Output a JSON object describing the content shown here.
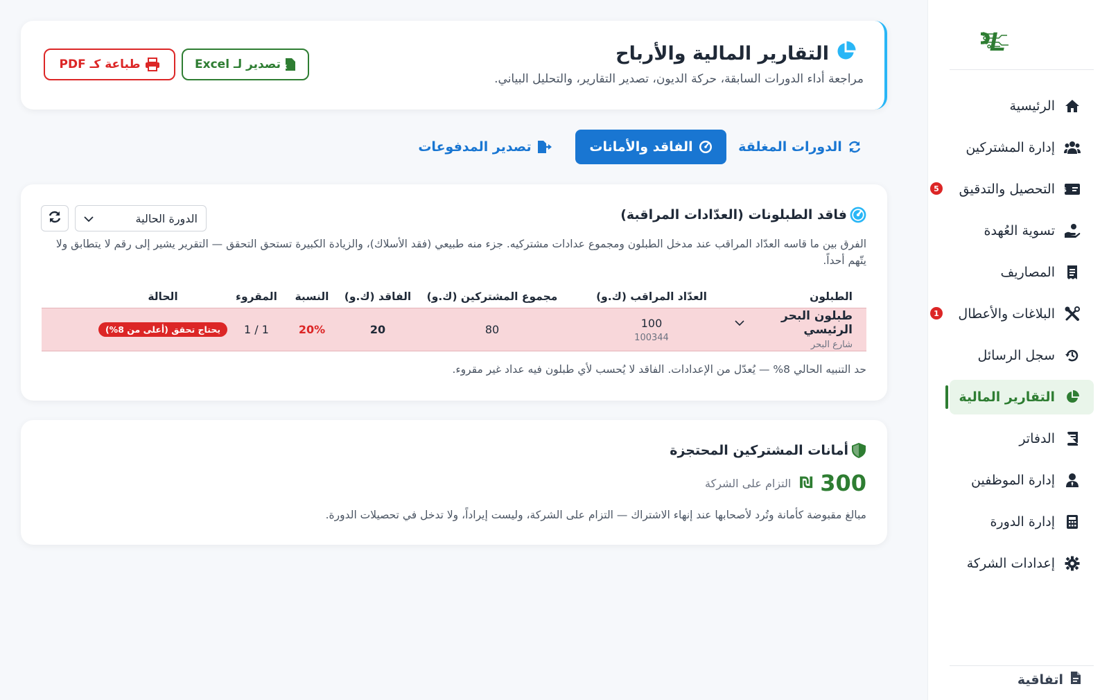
{
  "sidebar": {
    "logo_text": "PL",
    "items": [
      {
        "label": "الرئيسية",
        "icon": "home-icon"
      },
      {
        "label": "إدارة المشتركين",
        "icon": "users-icon"
      },
      {
        "label": "التحصيل والتدقيق",
        "icon": "money-card-icon",
        "badge": "5"
      },
      {
        "label": "تسوية العُهدة",
        "icon": "hand-coin-icon"
      },
      {
        "label": "المصاريف",
        "icon": "receipt-icon"
      },
      {
        "label": "البلاغات والأعطال",
        "icon": "tools-icon",
        "badge": "1"
      },
      {
        "label": "سجل الرسائل",
        "icon": "history-icon"
      },
      {
        "label": "التقارير المالية",
        "icon": "pie-chart-icon",
        "active": true
      },
      {
        "label": "الدفاتر",
        "icon": "book-icon"
      },
      {
        "label": "إدارة الموظفين",
        "icon": "user-tie-icon"
      },
      {
        "label": "إدارة الدورة",
        "icon": "calculator-icon"
      },
      {
        "label": "إعدادات الشركة",
        "icon": "gear-icon"
      }
    ],
    "bottom_label": "اتفاقية"
  },
  "header": {
    "title": "التقارير المالية والأرباح",
    "subtitle": "مراجعة أداء الدورات السابقة، حركة الديون، تصدير التقارير، والتحليل البياني.",
    "excel_label": "تصدير لـ Excel",
    "pdf_label": "طباعة كـ PDF"
  },
  "tabs": {
    "closed": "الدورات المغلقة",
    "loss": "الفاقد والأمانات",
    "export": "تصدير المدفوعات"
  },
  "loss_card": {
    "title": "فاقد الطبلونات (العدّادات المراقبة)",
    "cycle_select": "الدورة الحالية",
    "description": "الفرق بين ما قاسه العدّاد المراقب عند مدخل الطبلون ومجموع عدادات مشتركيه. جزء منه طبيعي (فقد الأسلاك)، والزيادة الكبيرة تستحق التحقق — التقرير يشير إلى رقم لا يتطابق ولا يتّهم أحداً.",
    "columns": [
      "الطبلون",
      "العدّاد المراقب (ك.و)",
      "مجموع المشتركين (ك.و)",
      "الفاقد (ك.و)",
      "النسبة",
      "المقروء",
      "الحالة"
    ],
    "rows": [
      {
        "panel": "طبلون البحر الرئيسي",
        "street": "شارع البحر",
        "meter": "100",
        "meter_id": "100344",
        "subscribers_total": "80",
        "loss": "20",
        "ratio": "20%",
        "read": "1 / 1",
        "status": "يحتاج تحقق (أعلى من 8%)"
      }
    ],
    "note": "حد التنبيه الحالي 8% — يُعدّل من الإعدادات. الفاقد لا يُحسب لأي طبلون فيه عداد غير مقروء."
  },
  "deposit_card": {
    "title": "أمانات المشتركين المحتجزة",
    "amount": "300",
    "currency": "₪",
    "amount_label": "التزام على الشركة",
    "description": "مبالغ مقبوضة كأمانة وتُرد لأصحابها عند إنهاء الاشتراك — التزام على الشركة، وليست إيراداً، ولا تدخل في تحصيلات الدورة."
  },
  "colors": {
    "accent_blue": "#1976d2",
    "brand_green": "#2e7d32",
    "danger_red": "#dc2626",
    "row_alert_bg": "#f8d7da"
  }
}
